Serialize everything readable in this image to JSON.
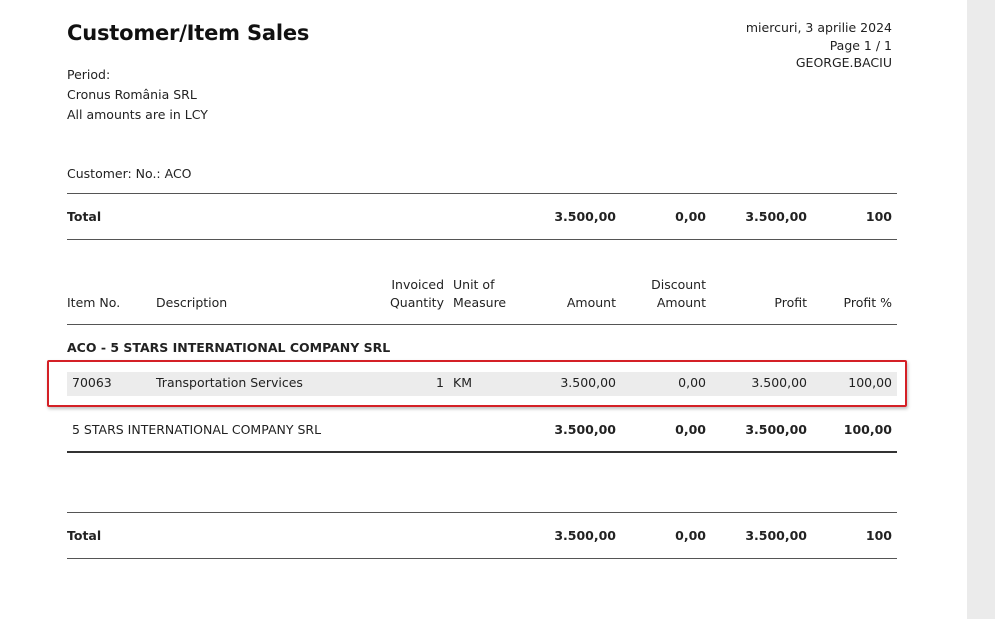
{
  "report": {
    "title": "Customer/Item Sales",
    "date": "miercuri, 3 aprilie 2024",
    "page": "Page 1 / 1",
    "user": "GEORGE.BACIU",
    "period_label": "Period:",
    "company": "Cronus România SRL",
    "currency_note": "All amounts are in LCY"
  },
  "filter": {
    "customer": "Customer: No.: ACO"
  },
  "summary_total": {
    "label": "Total",
    "amount": "3.500,00",
    "discount": "0,00",
    "profit": "3.500,00",
    "profit_pct": "100"
  },
  "columns": {
    "item_no": "Item No.",
    "description": "Description",
    "invoiced_qty_1": "Invoiced",
    "invoiced_qty_2": "Quantity",
    "uom_1": "Unit of",
    "uom_2": "Measure",
    "amount": "Amount",
    "discount_1": "Discount",
    "discount_2": "Amount",
    "profit": "Profit",
    "profit_pct": "Profit %"
  },
  "customer_group": {
    "header": "ACO - 5 STARS INTERNATIONAL COMPANY SRL",
    "lines": [
      {
        "item_no": "70063",
        "description": "Transportation Services",
        "quantity": "1",
        "uom": "KM",
        "amount": "3.500,00",
        "discount": "0,00",
        "profit": "3.500,00",
        "profit_pct": "100,00"
      }
    ],
    "subtotal": {
      "label": "5 STARS INTERNATIONAL COMPANY SRL",
      "amount": "3.500,00",
      "discount": "0,00",
      "profit": "3.500,00",
      "profit_pct": "100,00"
    }
  },
  "grand_total": {
    "label": "Total",
    "amount": "3.500,00",
    "discount": "0,00",
    "profit": "3.500,00",
    "profit_pct": "100"
  },
  "colors": {
    "highlight_border": "#d42026",
    "row_background": "#ececec"
  }
}
